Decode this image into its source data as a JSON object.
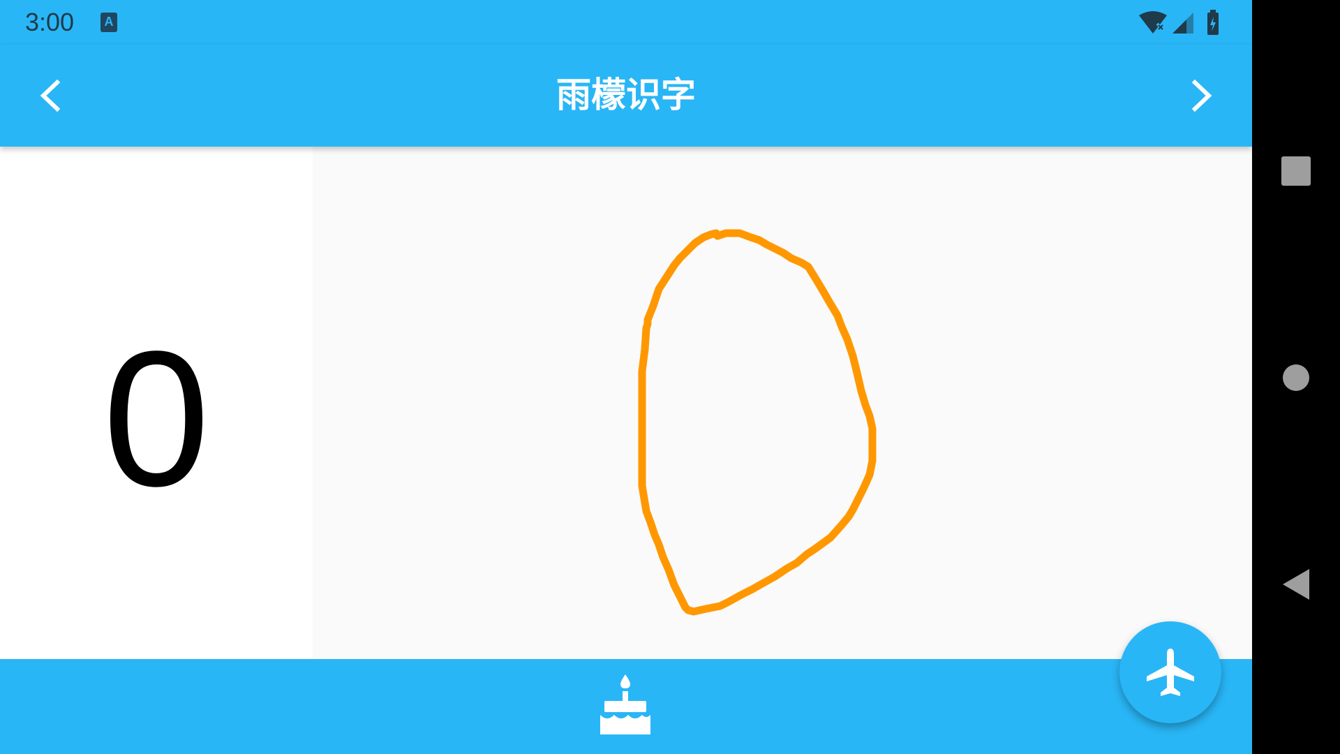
{
  "status_bar": {
    "time": "3:00",
    "a_icon_letter": "A"
  },
  "app_bar": {
    "title": "雨檬识字"
  },
  "score": {
    "value": "0"
  },
  "icons": {
    "back": "chevron-left-icon",
    "forward": "chevron-right-icon",
    "cake": "cake-icon",
    "fab": "airplane-icon",
    "wifi": "wifi-off-icon",
    "signal": "signal-icon",
    "battery": "battery-charging-icon"
  },
  "colors": {
    "primary": "#29b6f6",
    "stroke": "#ff9800",
    "score_text": "#000000"
  }
}
